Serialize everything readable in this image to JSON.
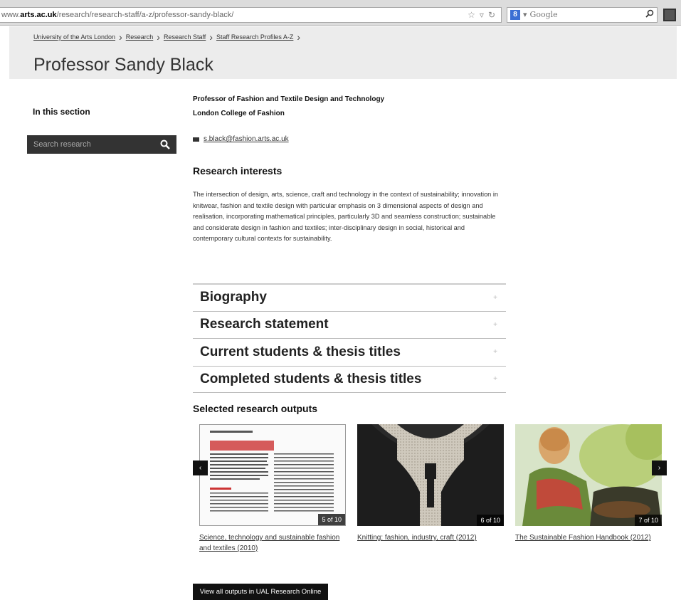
{
  "browser": {
    "url_prefix": "www.",
    "url_domain": "arts.ac.uk",
    "url_path": "/research/research-staff/a-z/professor-sandy-black/",
    "search_placeholder": "Google"
  },
  "breadcrumb": [
    {
      "label": "University of the Arts London"
    },
    {
      "label": "Research"
    },
    {
      "label": "Research Staff"
    },
    {
      "label": "Staff Research Profiles A-Z"
    }
  ],
  "page": {
    "title": "Professor Sandy Black"
  },
  "sidebar": {
    "heading": "In this section",
    "search_placeholder": "Search research"
  },
  "profile": {
    "job_title": "Professor of Fashion and Textile Design and Technology",
    "college": "London College of Fashion",
    "email": "s.black@fashion.arts.ac.uk"
  },
  "research_interests": {
    "heading": "Research interests",
    "text": "The intersection of design, arts, science, craft and technology in the context of sustainability; innovation in knitwear, fashion and textile design with particular emphasis on 3 dimensional aspects of design and realisation, incorporating mathematical principles, particularly 3D and seamless construction; sustainable and considerate design in fashion and textiles; inter-disciplinary design in social, historical and contemporary cultural contexts for sustainability."
  },
  "accordion": [
    {
      "label": "Biography",
      "toggle": "+"
    },
    {
      "label": "Research statement",
      "toggle": "+"
    },
    {
      "label": "Current students & thesis titles",
      "toggle": "+"
    },
    {
      "label": "Completed students & thesis titles",
      "toggle": "+"
    }
  ],
  "outputs": {
    "heading": "Selected research outputs",
    "items": [
      {
        "title": "Science, technology and sustainable fashion and textiles (2010)",
        "count": "5 of 10"
      },
      {
        "title": "Knitting: fashion, industry, craft (2012)",
        "count": "6 of 10"
      },
      {
        "title": "The Sustainable Fashion Handbook (2012)",
        "count": "7 of 10"
      }
    ],
    "prev": "‹",
    "next": "›",
    "view_all": "View all outputs in UAL Research Online"
  }
}
